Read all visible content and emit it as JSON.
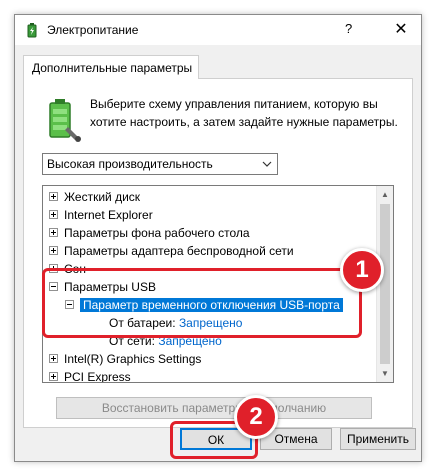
{
  "window": {
    "title": "Электропитание",
    "help_label": "?",
    "close_label": "✕",
    "title_icon": "power-options-icon"
  },
  "tab": {
    "label": "Дополнительные параметры"
  },
  "description": "Выберите схему управления питанием, которую вы хотите настроить, а затем задайте нужные параметры.",
  "plan_select": {
    "value": "Высокая производительность",
    "icon": "chevron-down-icon"
  },
  "tree": {
    "items": [
      {
        "label": "Жесткий диск",
        "state": "collapsed"
      },
      {
        "label": "Internet Explorer",
        "state": "collapsed"
      },
      {
        "label": "Параметры фона рабочего стола",
        "state": "collapsed"
      },
      {
        "label": "Параметры адаптера беспроводной сети",
        "state": "collapsed"
      },
      {
        "label": "Сон",
        "state": "collapsed"
      },
      {
        "label": "Параметры USB",
        "state": "expanded"
      },
      {
        "label": "Параметр временного отключения USB-порта",
        "state": "expanded"
      },
      {
        "label": "От батареи:",
        "value": "Запрещено"
      },
      {
        "label": "От сети:",
        "value": "Запрещено"
      },
      {
        "label": "Intel(R) Graphics Settings",
        "state": "collapsed"
      },
      {
        "label": "PCI Express",
        "state": "collapsed"
      }
    ]
  },
  "restore_button": {
    "label": "Восстановить параметры по умолчанию"
  },
  "buttons": {
    "ok": "ОК",
    "cancel": "Отмена",
    "apply": "Применить"
  },
  "annotations": {
    "badge_1": "1",
    "badge_2": "2"
  },
  "colors": {
    "accent": "#0078d7",
    "highlight": "#e0202a",
    "link": "#0066cc"
  }
}
